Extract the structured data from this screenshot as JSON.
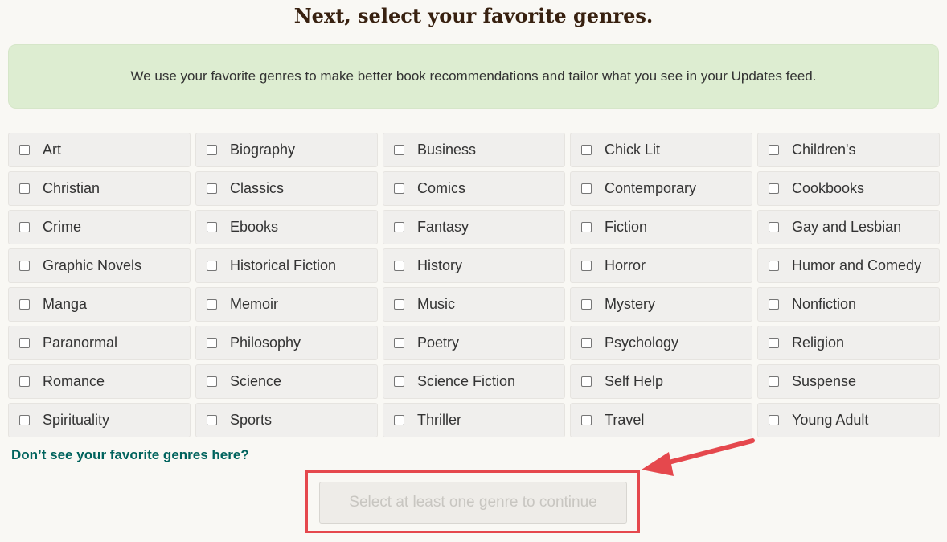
{
  "page": {
    "title": "Next, select your favorite genres.",
    "info_text": "We use your favorite genres to make better book recommendations and tailor what you see in your Updates feed.",
    "missing_link": "Don’t see your favorite genres here?",
    "continue_button": "Select at least one genre to continue"
  },
  "genres": [
    "Art",
    "Biography",
    "Business",
    "Chick Lit",
    "Children's",
    "Christian",
    "Classics",
    "Comics",
    "Contemporary",
    "Cookbooks",
    "Crime",
    "Ebooks",
    "Fantasy",
    "Fiction",
    "Gay and Lesbian",
    "Graphic Novels",
    "Historical Fiction",
    "History",
    "Horror",
    "Humor and Comedy",
    "Manga",
    "Memoir",
    "Music",
    "Mystery",
    "Nonfiction",
    "Paranormal",
    "Philosophy",
    "Poetry",
    "Psychology",
    "Religion",
    "Romance",
    "Science",
    "Science Fiction",
    "Self Help",
    "Suspense",
    "Spirituality",
    "Sports",
    "Thriller",
    "Travel",
    "Young Adult"
  ],
  "colors": {
    "title": "#382110",
    "info_box": "#ddedd1",
    "link": "#00635d",
    "annotation": "#e5484d"
  }
}
